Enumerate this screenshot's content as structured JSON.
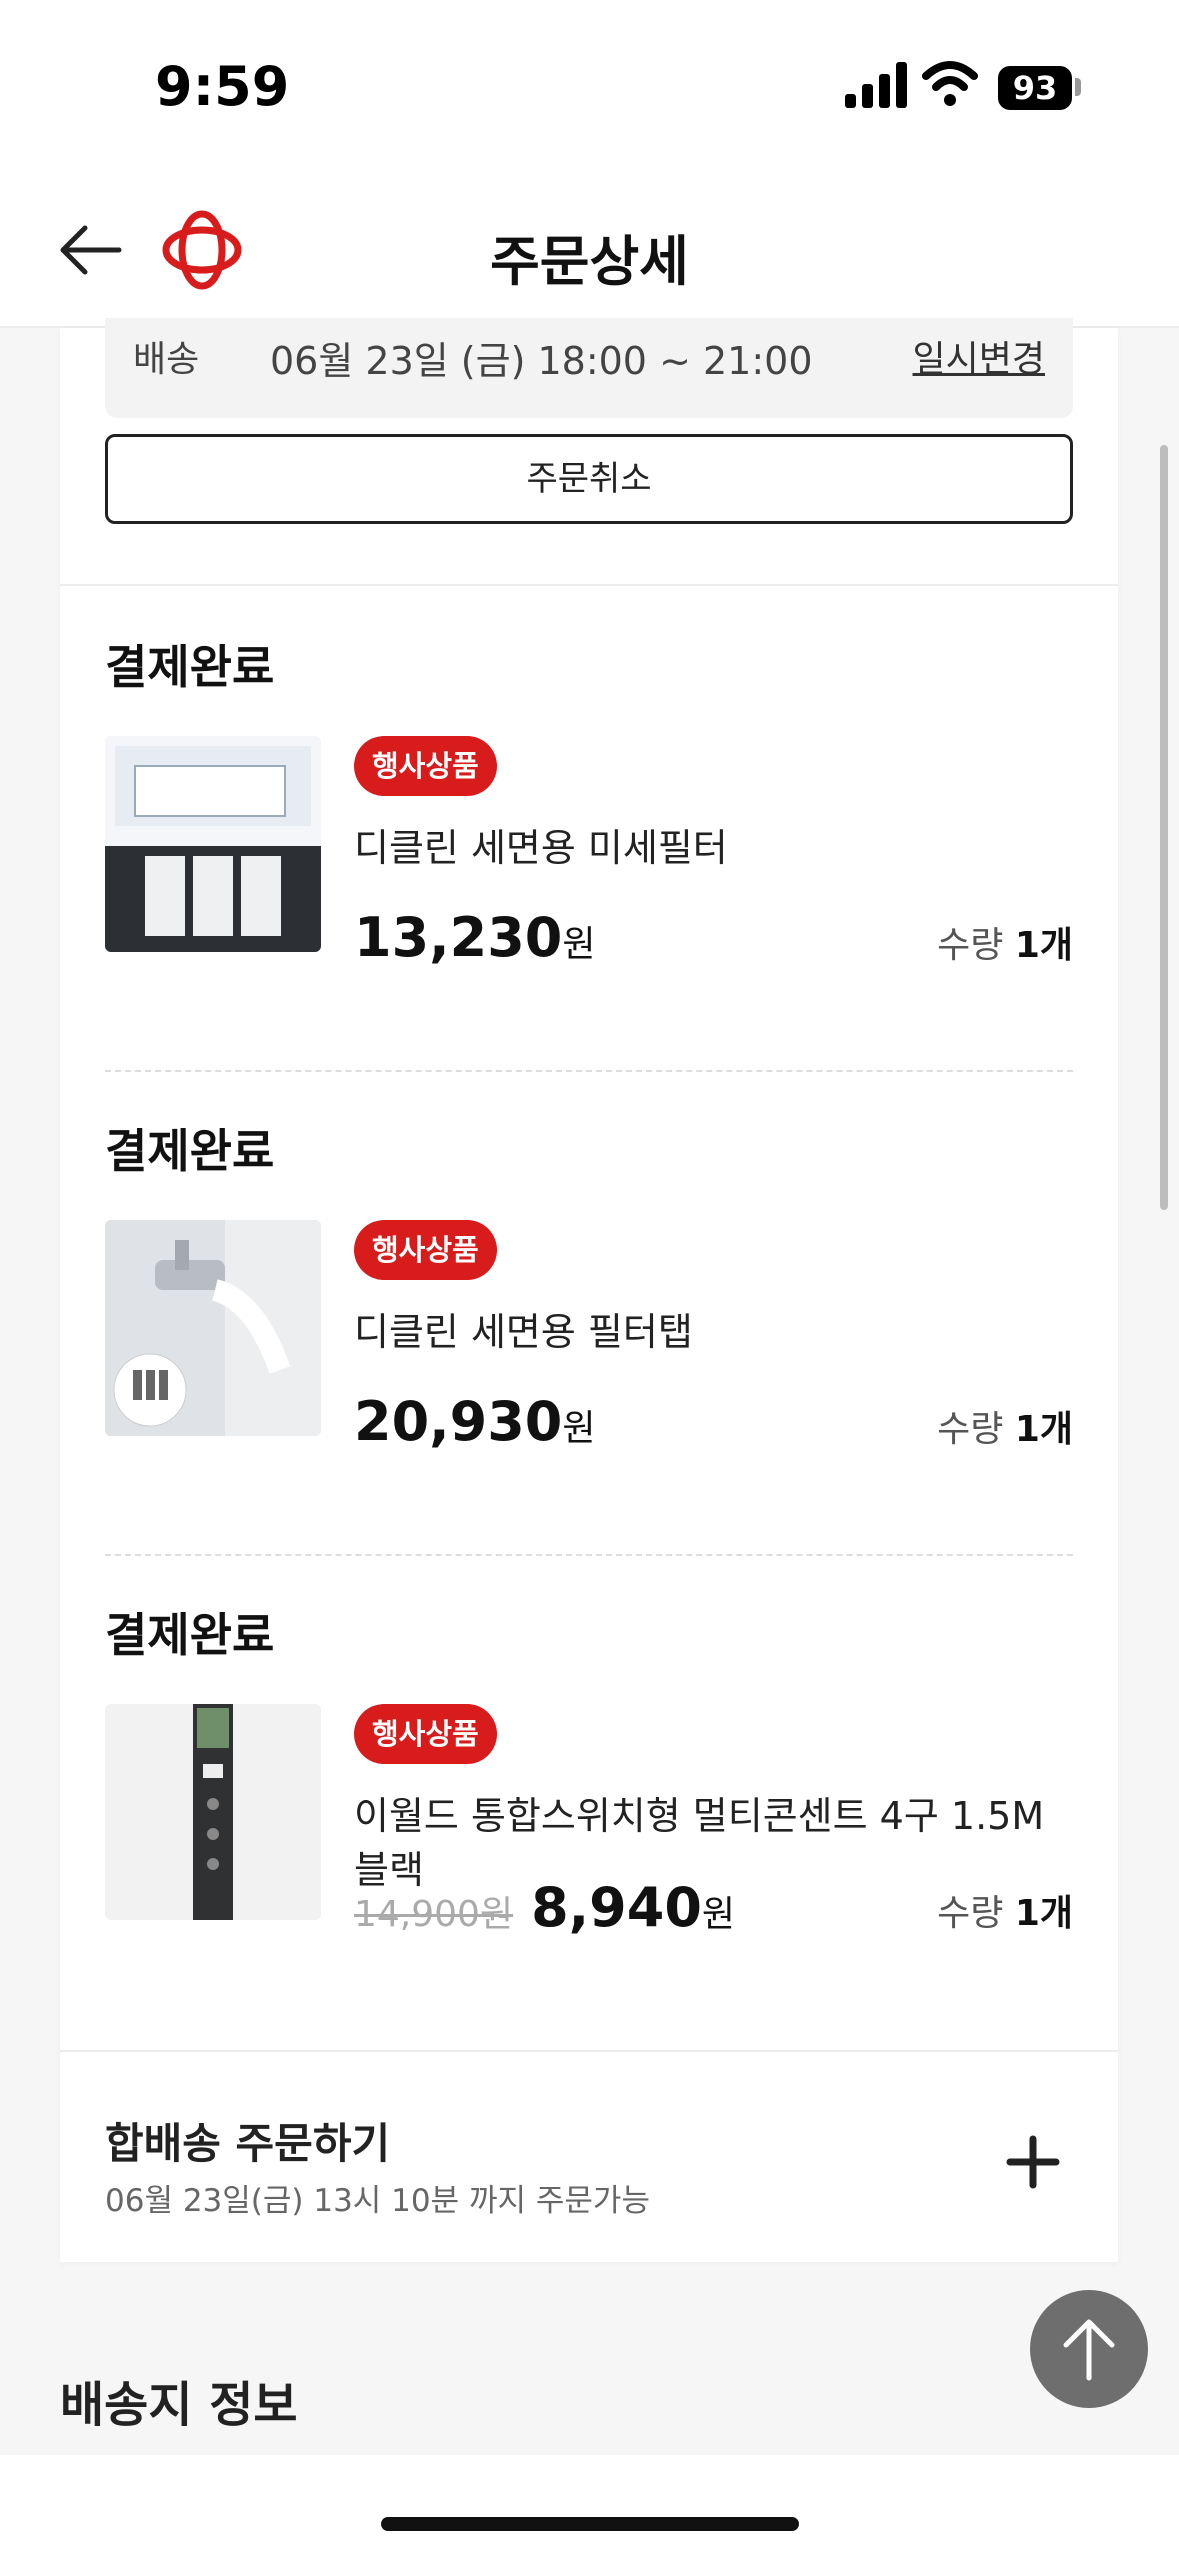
{
  "status_bar": {
    "time": "9:59",
    "battery": "93"
  },
  "header": {
    "title": "주문상세"
  },
  "delivery": {
    "label": "배송",
    "time": "06월 23일 (금) 18:00 ~ 21:00",
    "change_label": "일시변경"
  },
  "cancel_label": "주문취소",
  "items": [
    {
      "status": "결제완료",
      "badge": "행사상품",
      "name": "디클린 세면용 미세필터",
      "old_price": "",
      "price": "13,230",
      "unit": "원",
      "qty_label": "수량",
      "qty_value": "1개"
    },
    {
      "status": "결제완료",
      "badge": "행사상품",
      "name": "디클린 세면용 필터탭",
      "old_price": "",
      "price": "20,930",
      "unit": "원",
      "qty_label": "수량",
      "qty_value": "1개"
    },
    {
      "status": "결제완료",
      "badge": "행사상품",
      "name": "이월드 통합스위치형 멀티콘센트 4구 1.5M 블랙",
      "old_price": "14,900원",
      "price": "8,940",
      "unit": "원",
      "qty_label": "수량",
      "qty_value": "1개"
    }
  ],
  "combine": {
    "title": "합배송 주문하기",
    "subtitle": "06월 23일(금) 13시 10분 까지 주문가능"
  },
  "section_title": "배송지 정보",
  "colors": {
    "accent": "#d81b1b",
    "text": "#222222",
    "background": "#f6f6f6"
  },
  "icons": [
    "back-arrow-icon",
    "brand-logo-icon",
    "plus-icon",
    "arrow-up-icon"
  ]
}
